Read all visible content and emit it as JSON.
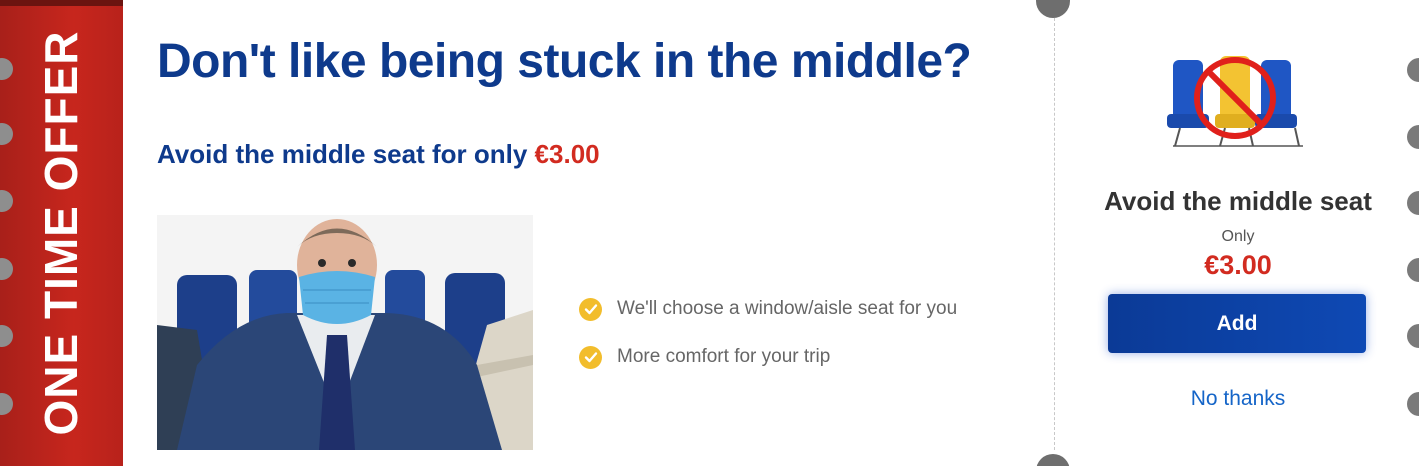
{
  "banner": {
    "text": "ONE TIME OFFER"
  },
  "headline": "Don't like being stuck in the middle?",
  "subline": {
    "text": "Avoid the middle seat for only",
    "price": "€3.00"
  },
  "benefits": [
    {
      "icon": "check-icon",
      "text": "We'll choose a window/aisle seat for you"
    },
    {
      "icon": "check-icon",
      "text": "More comfort for your trip"
    }
  ],
  "offer": {
    "title": "Avoid the middle seat",
    "only_label": "Only",
    "price": "€3.00",
    "add_label": "Add",
    "decline_label": "No thanks"
  },
  "colors": {
    "banner_red": "#c7261d",
    "brand_blue": "#0e3a8c",
    "price_red": "#d22b20",
    "check_yellow": "#f2bd2c",
    "link_blue": "#1565c8"
  }
}
